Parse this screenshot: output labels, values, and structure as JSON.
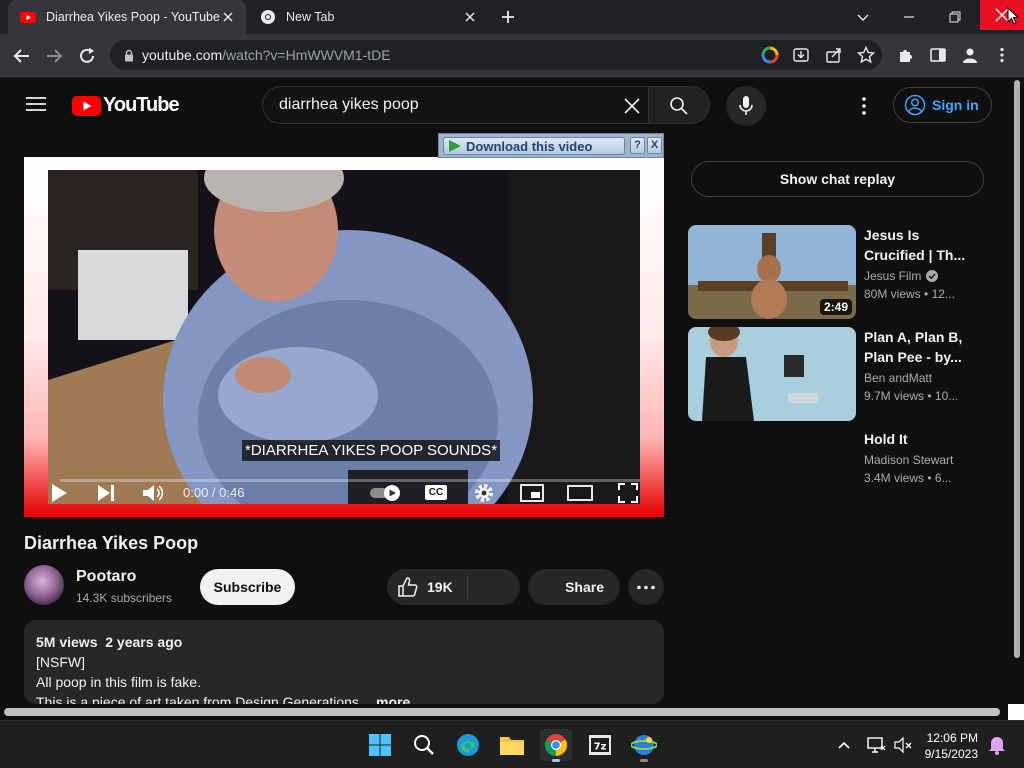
{
  "browser": {
    "tabs": [
      {
        "title": "Diarrhea Yikes Poop - YouTube",
        "active": true
      },
      {
        "title": "New Tab",
        "active": false
      }
    ],
    "url_host": "youtube.com",
    "url_path": "/watch?v=HmWWVM1-tDE"
  },
  "header": {
    "logo_text": "YouTube",
    "search_value": "diarrhea yikes poop",
    "signin_label": "Sign in"
  },
  "download_overlay": {
    "label": "Download this video",
    "help": "?",
    "close": "X"
  },
  "player": {
    "caption": "*DIARRHEA YIKES POOP SOUNDS*",
    "time": "0:00 / 0:46",
    "cc_label": "CC"
  },
  "video": {
    "title": "Diarrhea Yikes Poop",
    "channel": "Pootaro",
    "subscribers": "14.3K subscribers",
    "subscribe_label": "Subscribe",
    "likes": "19K",
    "share_label": "Share"
  },
  "description": {
    "meta": "5M views  2 years ago",
    "lines": [
      "[NSFW]",
      "All poop in this film is fake.",
      "This is a piece of art taken from Design Generations"
    ],
    "ellipsis": "...",
    "more": "more"
  },
  "sidebar": {
    "chat_replay": "Show chat replay",
    "recommendations": [
      {
        "title": "Jesus Is Crucified | Th...",
        "channel": "Jesus Film",
        "verified": true,
        "views": "80M views",
        "age": "12...",
        "duration": "2:49"
      },
      {
        "title": "Plan A, Plan B, Plan Pee - by...",
        "channel": "Ben andMatt",
        "verified": false,
        "views": "9.7M views",
        "age": "10...",
        "duration": ""
      },
      {
        "title": "Hold It",
        "channel": "Madison Stewart",
        "verified": false,
        "views": "3.4M views",
        "age": "6...",
        "duration": ""
      }
    ]
  },
  "taskbar": {
    "time": "12:06 PM",
    "date": "9/15/2023"
  },
  "colors": {
    "yt_red": "#ff0000",
    "link_blue": "#3ea6ff",
    "background": "#0f0f0f"
  }
}
